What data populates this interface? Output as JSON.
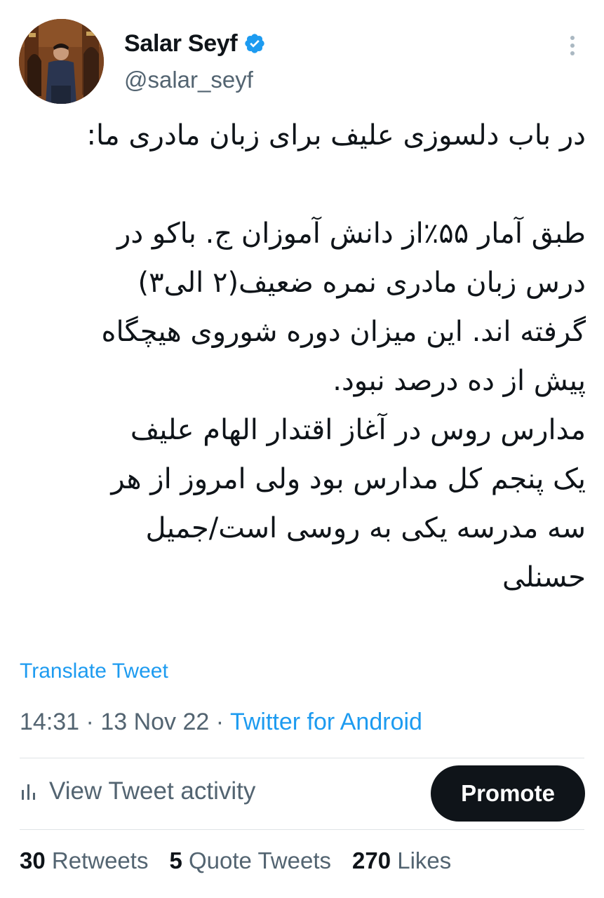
{
  "author": {
    "display_name": "Salar Seyf",
    "handle": "@salar_seyf",
    "verified": true
  },
  "icons": {
    "avatar": "avatar-photo",
    "verified": "verified-badge-icon",
    "more": "more-options-icon",
    "activity": "bar-chart-icon"
  },
  "tweet": {
    "lines": [
      "در باب دلسوزی علیف برای زبان مادری ما:",
      "",
      "طبق آمار ۵۵٪از دانش آموزان ج. باکو در",
      "درس زبان مادری نمره ضعیف(۲ الی۳)",
      "گرفته اند. این میزان دوره شوروی هیچگاه",
      "پیش از ده درصد نبود.",
      "مدارس روس در آغاز اقتدار الهام علیف",
      "یک پنجم کل مدارس بود ولی امروز از هر",
      "سه مدرسه یکی به روسی است/جمیل",
      "حسنلی"
    ],
    "translate_label": "Translate Tweet",
    "time": "14:31",
    "date": "13 Nov 22",
    "source": "Twitter for Android"
  },
  "actions": {
    "activity_label": "View Tweet activity",
    "promote_label": "Promote"
  },
  "stats": {
    "retweets_count": "30",
    "retweets_label": "Retweets",
    "quotes_count": "5",
    "quotes_label": "Quote Tweets",
    "likes_count": "270",
    "likes_label": "Likes"
  },
  "colors": {
    "accent": "#1d9bf0",
    "text": "#0f1419",
    "secondary": "#536471",
    "divider": "#dfe3e6"
  }
}
